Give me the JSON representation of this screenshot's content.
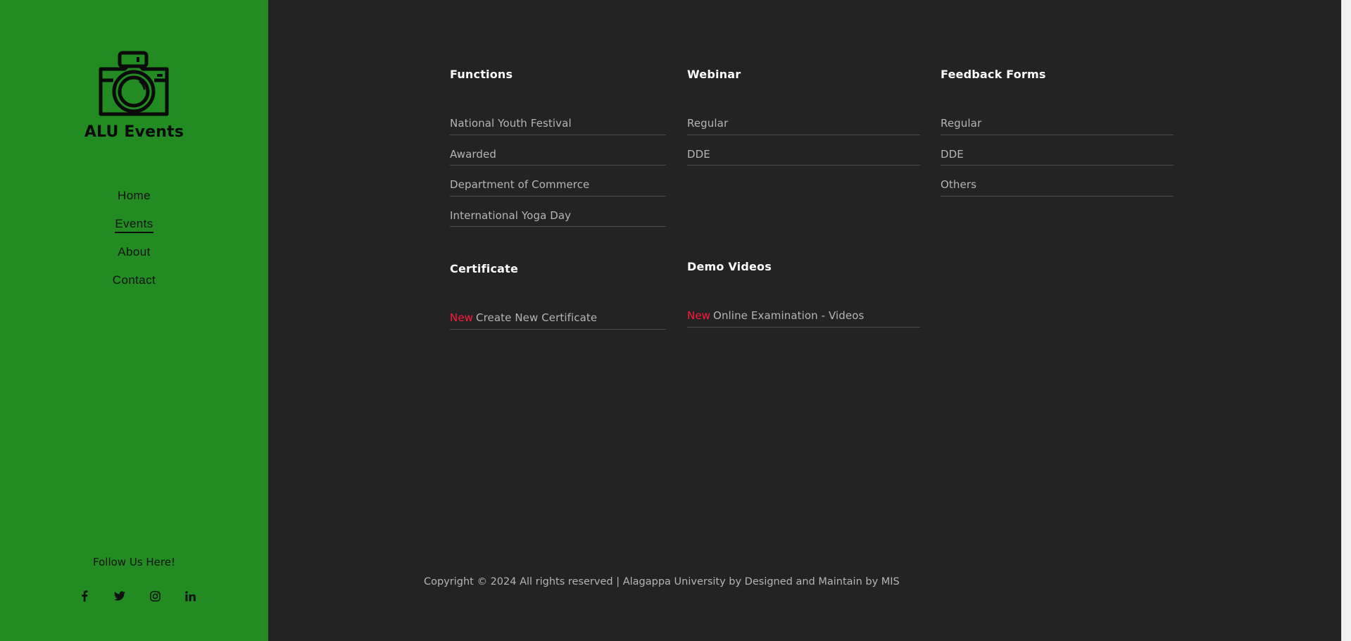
{
  "brand": {
    "name": "ALU Events",
    "logo_icon": "camera-icon"
  },
  "nav": {
    "items": [
      {
        "label": "Home"
      },
      {
        "label": "Events"
      },
      {
        "label": "About"
      },
      {
        "label": "Contact"
      }
    ],
    "active": "Events"
  },
  "sidebar": {
    "follow_label": "Follow Us Here!",
    "social": [
      "facebook-icon",
      "twitter-icon",
      "instagram-icon",
      "linkedin-icon"
    ]
  },
  "sections": {
    "functions": {
      "title": "Functions",
      "items": [
        "National Youth Festival",
        "Awarded",
        "Department of Commerce",
        "International Yoga Day"
      ]
    },
    "webinar": {
      "title": "Webinar",
      "items": [
        "Regular",
        "DDE"
      ]
    },
    "feedback": {
      "title": "Feedback Forms",
      "items": [
        "Regular",
        "DDE",
        "Others"
      ]
    },
    "certificate": {
      "title": "Certificate",
      "items": [
        {
          "badge": "New",
          "label": "Create New Certificate"
        }
      ]
    },
    "demo": {
      "title": "Demo Videos",
      "items": [
        {
          "badge": "New",
          "label": "Online Examination - Videos"
        }
      ]
    }
  },
  "footer": {
    "text": "Copyright © 2024 All rights reserved | Alagappa University by Designed and Maintain by MIS"
  },
  "colors": {
    "sidebar_bg": "#228b22",
    "main_bg": "#232323",
    "new_badge": "#ff1a3a"
  }
}
